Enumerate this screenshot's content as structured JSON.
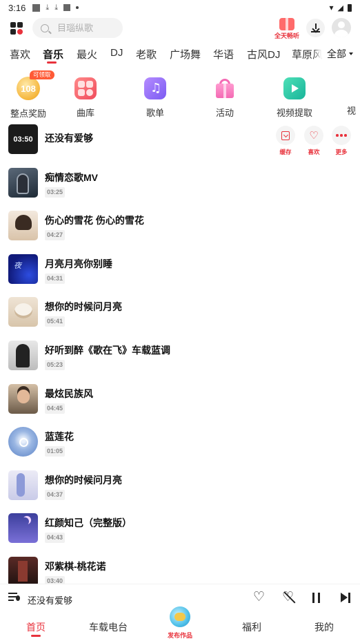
{
  "status_bar": {
    "time": "3:16"
  },
  "header": {
    "search_placeholder": "目瑙纵歌",
    "promo_label": "全天畅听"
  },
  "tabs": [
    "喜欢",
    "音乐",
    "最火",
    "DJ",
    "老歌",
    "广场舞",
    "华语",
    "古风DJ",
    "草原风"
  ],
  "active_tab": "音乐",
  "tab_all_label": "全部",
  "quick_entries": [
    {
      "label": "整点奖励",
      "badge": "可领取",
      "value": "108",
      "icon": "coin-icon"
    },
    {
      "label": "曲库",
      "icon": "library-icon"
    },
    {
      "label": "歌单",
      "icon": "playlist-icon"
    },
    {
      "label": "活动",
      "icon": "gift-icon"
    },
    {
      "label": "视频提取",
      "icon": "video-icon"
    },
    {
      "label": "视"
    }
  ],
  "songs": [
    {
      "title": "还没有爱够",
      "cover_text": "03:50"
    },
    {
      "title": "痴情恋歌MV",
      "duration": "03:25"
    },
    {
      "title": "伤心的雪花 伤心的雪花",
      "duration": "04:27"
    },
    {
      "title": "月亮月亮你别睡",
      "duration": "04:31"
    },
    {
      "title": "想你的时候问月亮",
      "duration": "05:41"
    },
    {
      "title": "好听到醉《歌在飞》车载蓝调",
      "duration": "05:23"
    },
    {
      "title": "最炫民族风",
      "duration": "04:45"
    },
    {
      "title": "蓝莲花",
      "duration": "01:05"
    },
    {
      "title": "想你的时候问月亮",
      "duration": "04:37"
    },
    {
      "title": "红颜知己（完整版）",
      "duration": "04:43"
    },
    {
      "title": "邓紫棋-桃花诺",
      "duration": "03:40"
    }
  ],
  "song_actions": {
    "cache": "缓存",
    "like": "喜欢",
    "more": "更多"
  },
  "player": {
    "now_playing": "还没有爱够"
  },
  "bottom_nav": {
    "home": "首页",
    "car_radio": "车载电台",
    "publish": "发布作品",
    "welfare": "福利",
    "mine": "我的"
  },
  "colors": {
    "accent": "#e8323c"
  }
}
